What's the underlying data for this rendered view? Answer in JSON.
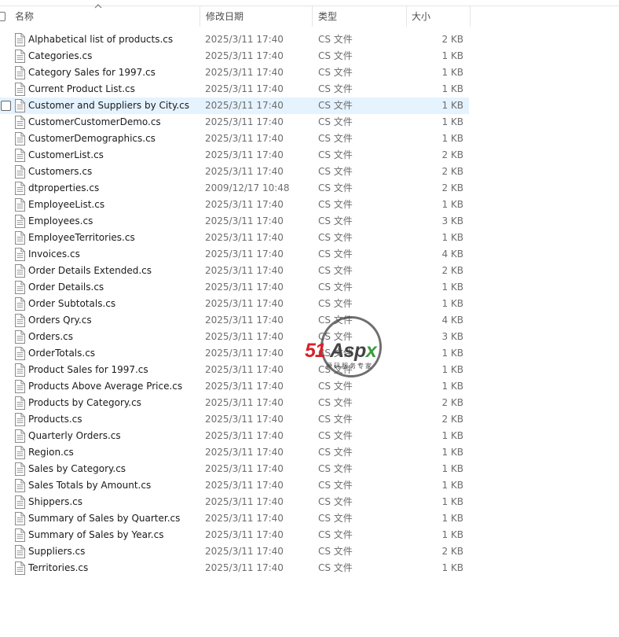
{
  "columns": {
    "name": "名称",
    "date": "修改日期",
    "type": "类型",
    "size": "大小"
  },
  "watermark": {
    "brand_number": "51",
    "brand_text": "Asp",
    "brand_x": "x",
    "tagline": "源码服务专家"
  },
  "files": [
    {
      "name": "Alphabetical list of products.cs",
      "date": "2025/3/11 17:40",
      "type": "CS 文件",
      "size": "2 KB"
    },
    {
      "name": "Categories.cs",
      "date": "2025/3/11 17:40",
      "type": "CS 文件",
      "size": "1 KB"
    },
    {
      "name": "Category Sales for 1997.cs",
      "date": "2025/3/11 17:40",
      "type": "CS 文件",
      "size": "1 KB"
    },
    {
      "name": "Current Product List.cs",
      "date": "2025/3/11 17:40",
      "type": "CS 文件",
      "size": "1 KB"
    },
    {
      "name": "Customer and Suppliers by City.cs",
      "date": "2025/3/11 17:40",
      "type": "CS 文件",
      "size": "1 KB",
      "selected": true
    },
    {
      "name": "CustomerCustomerDemo.cs",
      "date": "2025/3/11 17:40",
      "type": "CS 文件",
      "size": "1 KB"
    },
    {
      "name": "CustomerDemographics.cs",
      "date": "2025/3/11 17:40",
      "type": "CS 文件",
      "size": "1 KB"
    },
    {
      "name": "CustomerList.cs",
      "date": "2025/3/11 17:40",
      "type": "CS 文件",
      "size": "2 KB"
    },
    {
      "name": "Customers.cs",
      "date": "2025/3/11 17:40",
      "type": "CS 文件",
      "size": "2 KB"
    },
    {
      "name": "dtproperties.cs",
      "date": "2009/12/17 10:48",
      "type": "CS 文件",
      "size": "2 KB"
    },
    {
      "name": "EmployeeList.cs",
      "date": "2025/3/11 17:40",
      "type": "CS 文件",
      "size": "1 KB"
    },
    {
      "name": "Employees.cs",
      "date": "2025/3/11 17:40",
      "type": "CS 文件",
      "size": "3 KB"
    },
    {
      "name": "EmployeeTerritories.cs",
      "date": "2025/3/11 17:40",
      "type": "CS 文件",
      "size": "1 KB"
    },
    {
      "name": "Invoices.cs",
      "date": "2025/3/11 17:40",
      "type": "CS 文件",
      "size": "4 KB"
    },
    {
      "name": "Order Details Extended.cs",
      "date": "2025/3/11 17:40",
      "type": "CS 文件",
      "size": "2 KB"
    },
    {
      "name": "Order Details.cs",
      "date": "2025/3/11 17:40",
      "type": "CS 文件",
      "size": "1 KB"
    },
    {
      "name": "Order Subtotals.cs",
      "date": "2025/3/11 17:40",
      "type": "CS 文件",
      "size": "1 KB"
    },
    {
      "name": "Orders Qry.cs",
      "date": "2025/3/11 17:40",
      "type": "CS 文件",
      "size": "4 KB"
    },
    {
      "name": "Orders.cs",
      "date": "2025/3/11 17:40",
      "type": "CS 文件",
      "size": "3 KB"
    },
    {
      "name": "OrderTotals.cs",
      "date": "2025/3/11 17:40",
      "type": "CS 文件",
      "size": "1 KB"
    },
    {
      "name": "Product Sales for 1997.cs",
      "date": "2025/3/11 17:40",
      "type": "CS 文件",
      "size": "1 KB"
    },
    {
      "name": "Products Above Average Price.cs",
      "date": "2025/3/11 17:40",
      "type": "CS 文件",
      "size": "1 KB"
    },
    {
      "name": "Products by Category.cs",
      "date": "2025/3/11 17:40",
      "type": "CS 文件",
      "size": "2 KB"
    },
    {
      "name": "Products.cs",
      "date": "2025/3/11 17:40",
      "type": "CS 文件",
      "size": "2 KB"
    },
    {
      "name": "Quarterly Orders.cs",
      "date": "2025/3/11 17:40",
      "type": "CS 文件",
      "size": "1 KB"
    },
    {
      "name": "Region.cs",
      "date": "2025/3/11 17:40",
      "type": "CS 文件",
      "size": "1 KB"
    },
    {
      "name": "Sales by Category.cs",
      "date": "2025/3/11 17:40",
      "type": "CS 文件",
      "size": "1 KB"
    },
    {
      "name": "Sales Totals by Amount.cs",
      "date": "2025/3/11 17:40",
      "type": "CS 文件",
      "size": "1 KB"
    },
    {
      "name": "Shippers.cs",
      "date": "2025/3/11 17:40",
      "type": "CS 文件",
      "size": "1 KB"
    },
    {
      "name": "Summary of Sales by Quarter.cs",
      "date": "2025/3/11 17:40",
      "type": "CS 文件",
      "size": "1 KB"
    },
    {
      "name": "Summary of Sales by Year.cs",
      "date": "2025/3/11 17:40",
      "type": "CS 文件",
      "size": "1 KB"
    },
    {
      "name": "Suppliers.cs",
      "date": "2025/3/11 17:40",
      "type": "CS 文件",
      "size": "2 KB"
    },
    {
      "name": "Territories.cs",
      "date": "2025/3/11 17:40",
      "type": "CS 文件",
      "size": "1 KB"
    }
  ]
}
